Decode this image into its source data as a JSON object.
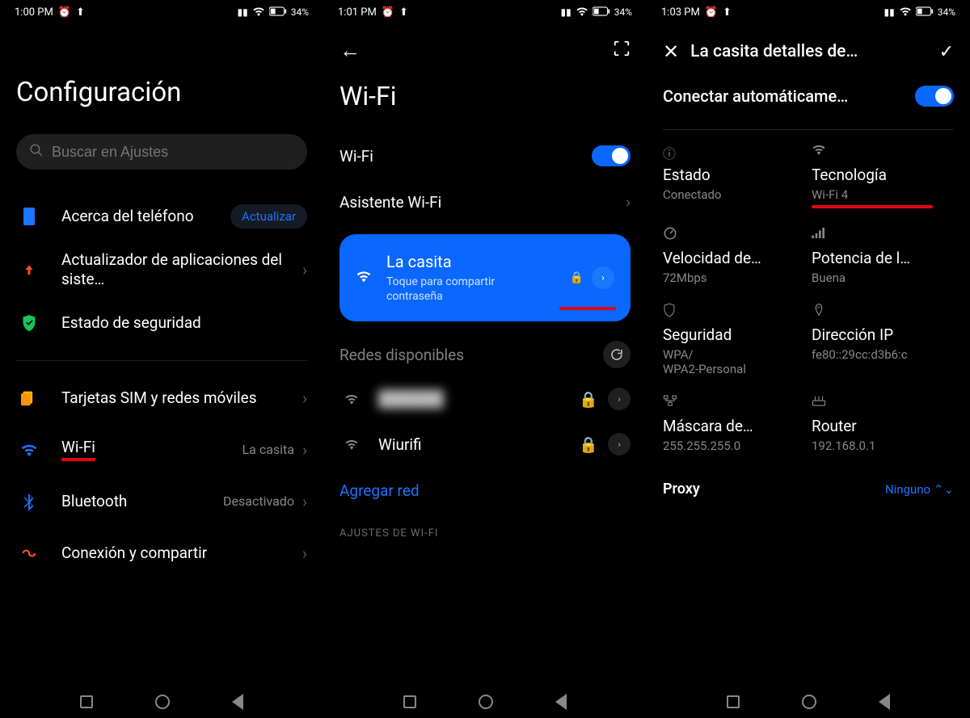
{
  "screen1": {
    "status": {
      "time": "1:00 PM",
      "battery": "34%"
    },
    "title": "Configuración",
    "search_placeholder": "Buscar en Ajustes",
    "update_badge": "Actualizar",
    "items": {
      "about": "Acerca del teléfono",
      "updater": "Actualizador de aplicaciones del siste…",
      "security": "Estado de seguridad",
      "sim": "Tarjetas SIM y redes móviles",
      "wifi": "Wi-Fi",
      "wifi_status": "La casita",
      "bluetooth": "Bluetooth",
      "bluetooth_status": "Desactivado",
      "share": "Conexión y compartir"
    }
  },
  "screen2": {
    "status": {
      "time": "1:01 PM",
      "battery": "34%"
    },
    "title": "Wi-Fi",
    "wifi_label": "Wi-Fi",
    "assistant_label": "Asistente Wi-Fi",
    "connected": {
      "name": "La casita",
      "subtitle": "Toque para compartir contraseña"
    },
    "available_section": "Redes disponibles",
    "networks": [
      {
        "name": "██████"
      },
      {
        "name": "Wiurifi"
      }
    ],
    "add_network": "Agregar red",
    "bottom_section": "AJUSTES DE WI-FI"
  },
  "screen3": {
    "status": {
      "time": "1:03 PM",
      "battery": "34%"
    },
    "title": "La casita detalles de…",
    "auto_connect": "Conectar automáticame…",
    "cells": {
      "state": {
        "label": "Estado",
        "value": "Conectado"
      },
      "tech": {
        "label": "Tecnología",
        "value": "Wi-Fi 4"
      },
      "speed": {
        "label": "Velocidad de…",
        "value": "72Mbps"
      },
      "signal": {
        "label": "Potencia de l…",
        "value": "Buena"
      },
      "security": {
        "label": "Seguridad",
        "value": "WPA/\nWPA2-Personal"
      },
      "ip": {
        "label": "Dirección IP",
        "value": "fe80::29cc:d3b6:c"
      },
      "mask": {
        "label": "Máscara de…",
        "value": "255.255.255.0"
      },
      "router": {
        "label": "Router",
        "value": "192.168.0.1"
      }
    },
    "proxy_label": "Proxy",
    "proxy_value": "Ninguno"
  }
}
